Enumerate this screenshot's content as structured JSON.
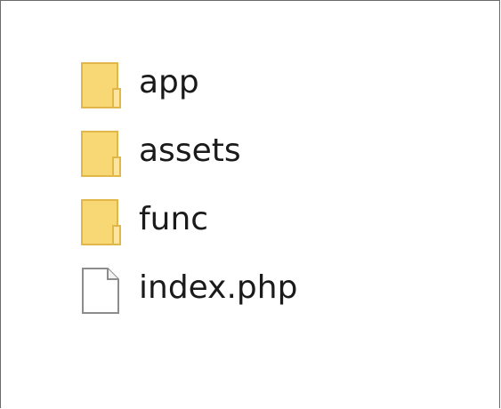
{
  "window": {
    "type": "file-explorer-pane"
  },
  "items": [
    {
      "name": "app",
      "kind": "folder",
      "icon": "folder-icon"
    },
    {
      "name": "assets",
      "kind": "folder",
      "icon": "folder-icon"
    },
    {
      "name": "func",
      "kind": "folder",
      "icon": "folder-icon"
    },
    {
      "name": "index.php",
      "kind": "file",
      "icon": "file-icon"
    }
  ],
  "colors": {
    "folder_fill": "#f8d775",
    "folder_edge": "#e2b74a",
    "file_fill": "#ffffff",
    "file_edge": "#8c8c8c",
    "text": "#1a1a1a"
  }
}
